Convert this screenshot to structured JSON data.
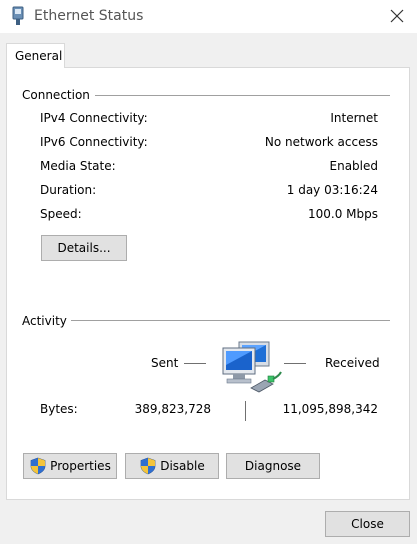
{
  "window": {
    "title": "Ethernet Status",
    "icon": "ethernet-adapter-icon",
    "close_icon": "close-icon"
  },
  "tabs": [
    {
      "label": "General",
      "selected": true
    }
  ],
  "connection": {
    "group_label": "Connection",
    "rows": [
      {
        "label": "IPv4 Connectivity:",
        "value": "Internet"
      },
      {
        "label": "IPv6 Connectivity:",
        "value": "No network access"
      },
      {
        "label": "Media State:",
        "value": "Enabled"
      },
      {
        "label": "Duration:",
        "value": "1 day 03:16:24"
      },
      {
        "label": "Speed:",
        "value": "100.0 Mbps"
      }
    ],
    "details_button": "Details..."
  },
  "activity": {
    "group_label": "Activity",
    "sent_label": "Sent",
    "received_label": "Received",
    "bytes_label": "Bytes:",
    "bytes_sent": "389,823,728",
    "bytes_received": "11,095,898,342",
    "icon": "network-computers-icon"
  },
  "buttons": {
    "properties": "Properties",
    "disable": "Disable",
    "diagnose": "Diagnose",
    "close": "Close",
    "shield_icon": "uac-shield-icon"
  },
  "colors": {
    "window_bg": "#f0f0f0",
    "panel_bg": "#ffffff",
    "button_bg": "#e1e1e1",
    "button_border": "#adadad",
    "group_line": "#a0a0a0"
  }
}
